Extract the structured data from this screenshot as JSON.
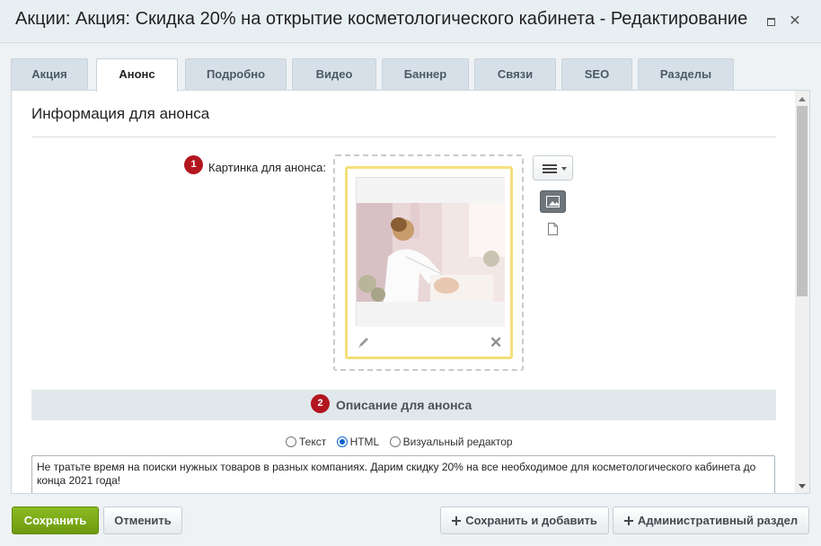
{
  "window": {
    "title": "Акции: Акция: Скидка 20% на открытие косметологического кабинета - Редактирование",
    "max_icon": "maximize-icon",
    "close_icon": "close-icon"
  },
  "tabs": [
    {
      "label": "Акция",
      "active": false
    },
    {
      "label": "Анонс",
      "active": true
    },
    {
      "label": "Подробно",
      "active": false
    },
    {
      "label": "Видео",
      "active": false
    },
    {
      "label": "Баннер",
      "active": false
    },
    {
      "label": "Связи",
      "active": false
    },
    {
      "label": "SEO",
      "active": false
    },
    {
      "label": "Разделы",
      "active": false
    }
  ],
  "section": {
    "title": "Информация для анонса"
  },
  "picture": {
    "badge": "1",
    "label": "Картинка для анонса:"
  },
  "description": {
    "badge": "2",
    "title": "Описание для анонса",
    "modes": [
      {
        "label": "Текст",
        "checked": false
      },
      {
        "label": "HTML",
        "checked": true
      },
      {
        "label": "Визуальный редактор",
        "checked": false
      }
    ],
    "text": "Не тратьте время на поиски нужных товаров в разных компаниях. Дарим скидку 20% на все необходимое для косметологического кабинета до конца 2021 года!"
  },
  "footer": {
    "save": "Сохранить",
    "cancel": "Отменить",
    "save_add": "Сохранить и добавить",
    "admin": "Административный раздел"
  },
  "colors": {
    "accent_green": "#7aa818",
    "badge_red": "#b3161f",
    "highlight_yellow": "#f4df7a"
  }
}
